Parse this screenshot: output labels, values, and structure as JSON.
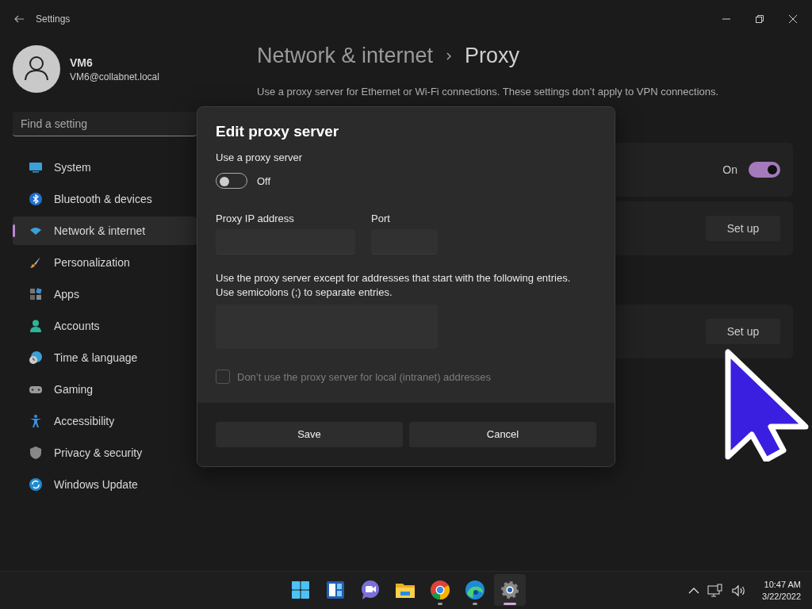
{
  "window": {
    "title": "Settings"
  },
  "account": {
    "name": "VM6",
    "email": "VM6@collabnet.local"
  },
  "search": {
    "placeholder": "Find a setting"
  },
  "nav": [
    {
      "label": "System",
      "selected": false
    },
    {
      "label": "Bluetooth & devices",
      "selected": false
    },
    {
      "label": "Network & internet",
      "selected": true
    },
    {
      "label": "Personalization",
      "selected": false
    },
    {
      "label": "Apps",
      "selected": false
    },
    {
      "label": "Accounts",
      "selected": false
    },
    {
      "label": "Time & language",
      "selected": false
    },
    {
      "label": "Gaming",
      "selected": false
    },
    {
      "label": "Accessibility",
      "selected": false
    },
    {
      "label": "Privacy & security",
      "selected": false
    },
    {
      "label": "Windows Update",
      "selected": false
    }
  ],
  "page": {
    "breadcrumb": "Network & internet",
    "title": "Proxy",
    "description": "Use a proxy server for Ethernet or Wi-Fi connections. These settings don’t apply to VPN connections."
  },
  "cards": [
    {
      "kind": "toggle",
      "state_label": "On",
      "on": true
    },
    {
      "kind": "button",
      "button": "Set up"
    },
    {
      "kind": "button",
      "button": "Set up"
    }
  ],
  "dialog": {
    "title": "Edit proxy server",
    "toggle_label": "Use a proxy server",
    "toggle": {
      "on": false,
      "label": "Off"
    },
    "fields": [
      {
        "label": "Proxy IP address"
      },
      {
        "label": "Port"
      }
    ],
    "exceptions_hint": [
      "Use the proxy server except for addresses that start with the following entries.",
      "Use semicolons (;) to separate entries."
    ],
    "checkbox": {
      "label": "Don’t use the proxy server for local (intranet) addresses",
      "checked": false,
      "disabled": true
    },
    "buttons": [
      "Save",
      "Cancel"
    ]
  },
  "taskbar": {
    "apps": [
      {
        "running": false,
        "selected": false
      },
      {
        "running": false,
        "selected": false
      },
      {
        "running": false,
        "selected": false
      },
      {
        "running": false,
        "selected": false
      },
      {
        "running": true,
        "selected": false
      },
      {
        "running": true,
        "selected": false
      },
      {
        "running": true,
        "selected": true
      }
    ],
    "time": "10:47 AM",
    "date": "3/22/2022"
  }
}
